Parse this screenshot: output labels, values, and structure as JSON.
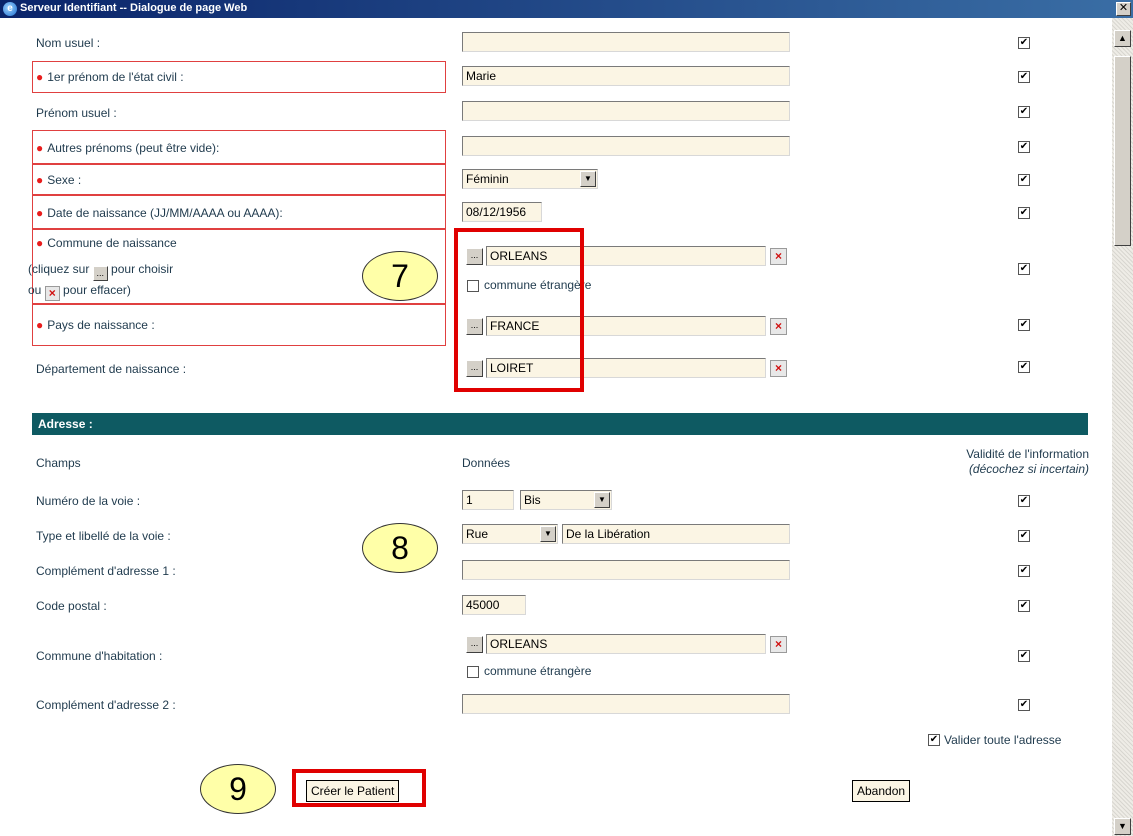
{
  "window": {
    "title": "Serveur Identifiant -- Dialogue de page Web",
    "close_glyph": "✕"
  },
  "identity": {
    "nom_usuel": {
      "label": "Nom usuel :",
      "value": ""
    },
    "premier_prenom": {
      "label": "1er prénom de l'état civil :",
      "value": "Marie"
    },
    "prenom_usuel": {
      "label": "Prénom usuel :",
      "value": ""
    },
    "autres_prenoms": {
      "label": "Autres prénoms (peut être vide):",
      "value": ""
    },
    "sexe": {
      "label": "Sexe :",
      "value": "Féminin"
    },
    "date_naissance": {
      "label": "Date de naissance (JJ/MM/AAAA ou AAAA):",
      "value": "08/12/1956"
    },
    "commune_naissance": {
      "label_line1": "Commune de naissance",
      "label_line2a": "(cliquez sur",
      "label_line2b": "pour choisir",
      "label_line3a": "ou",
      "label_line3b": "pour effacer)",
      "value": "ORLEANS",
      "etrangere_label": "commune étrangère"
    },
    "pays_naissance": {
      "label": "Pays de naissance :",
      "value": "FRANCE"
    },
    "departement_naissance": {
      "label": "Département de naissance :",
      "value": "LOIRET"
    }
  },
  "adresse": {
    "section_title": "Adresse :",
    "col_champs": "Champs",
    "col_donnees": "Données",
    "col_validite_line1": "Validité de l'information",
    "col_validite_line2": "(décochez si incertain)",
    "numero_voie": {
      "label": "Numéro de la voie :",
      "value": "1",
      "suffix": "Bis"
    },
    "type_libelle": {
      "label": "Type et libellé de la voie :",
      "type": "Rue",
      "libelle": "De la Libération"
    },
    "complement1": {
      "label": "Complément d'adresse 1 :",
      "value": ""
    },
    "code_postal": {
      "label": "Code postal :",
      "value": "45000"
    },
    "commune_habitation": {
      "label": "Commune d'habitation :",
      "value": "ORLEANS",
      "etrangere_label": "commune étrangère"
    },
    "complement2": {
      "label": "Complément d'adresse 2 :",
      "value": ""
    },
    "valider_adresse": "Valider toute l'adresse"
  },
  "buttons": {
    "creer": "Créer le Patient",
    "abandon": "Abandon"
  },
  "callouts": {
    "c7": "7",
    "c8": "8",
    "c9": "9"
  },
  "glyphs": {
    "check": "✔",
    "pick": "...",
    "clear": "×",
    "dropdown": "▼",
    "up": "▲",
    "down": "▼",
    "dot": "●"
  },
  "colors": {
    "section_header": "#0e5a62",
    "field_bg": "#fbf5e4",
    "highlight": "#e00000",
    "required_dot": "#e81c1c",
    "callout": "#ffffa8"
  }
}
